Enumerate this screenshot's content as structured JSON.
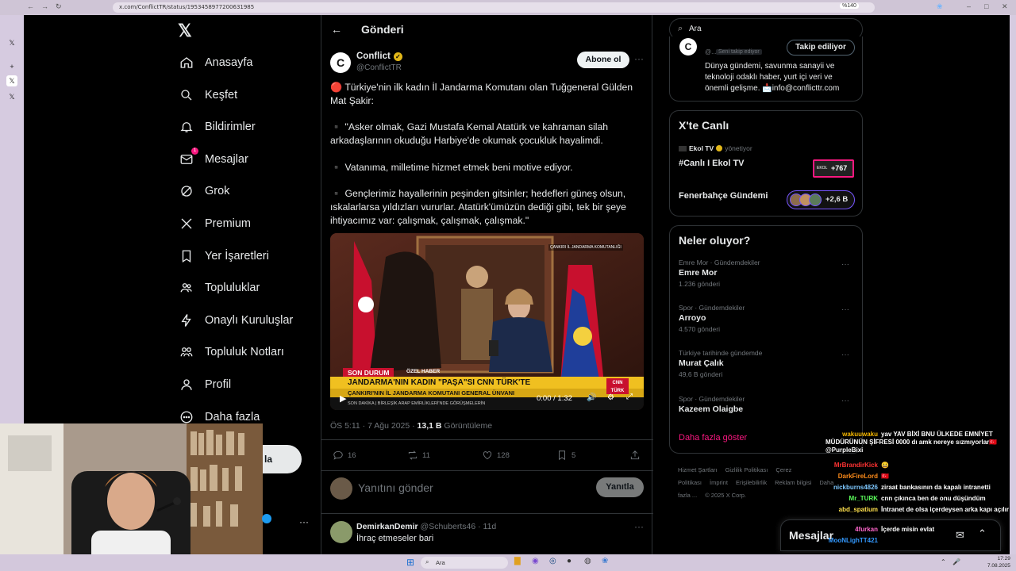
{
  "browser": {
    "url": "x.com/ConflictTR/status/1953458977200631985",
    "zoom": "%140"
  },
  "left_nav": {
    "items": [
      {
        "label": "Anasayfa",
        "icon": "home-icon"
      },
      {
        "label": "Keşfet",
        "icon": "search-icon"
      },
      {
        "label": "Bildirimler",
        "icon": "bell-icon"
      },
      {
        "label": "Mesajlar",
        "icon": "mail-icon",
        "badge": "1"
      },
      {
        "label": "Grok",
        "icon": "grok-icon"
      },
      {
        "label": "Premium",
        "icon": "x-logo-icon"
      },
      {
        "label": "Yer İşaretleri",
        "icon": "bookmark-icon"
      },
      {
        "label": "Topluluklar",
        "icon": "people-icon"
      },
      {
        "label": "Onaylı Kuruluşlar",
        "icon": "lightning-icon"
      },
      {
        "label": "Topluluk Notları",
        "icon": "notes-icon"
      },
      {
        "label": "Profil",
        "icon": "profile-icon"
      },
      {
        "label": "Daha fazla",
        "icon": "more-circle-icon"
      }
    ],
    "post_button_fragment": "la"
  },
  "main": {
    "header_title": "Gönderi",
    "author_name": "Conflict",
    "author_handle": "@ConflictTR",
    "subscribe_label": "Abone ol",
    "tweet_paragraphs": [
      "🔴 Türkiye'nin ilk kadın İl Jandarma Komutanı olan Tuğgeneral Gülden Mat Şakir:",
      "▪️ \"Asker olmak, Gazi Mustafa Kemal Atatürk ve kahraman silah arkadaşlarının okuduğu Harbiye'de okumak çocukluk hayalimdi.",
      "▪️ Vatanıma, milletime hizmet etmek beni motive ediyor.",
      "▪️ Gençlerimiz hayallerinin peşinden gitsinler; hedefleri güneş olsun, ıskalarlarsa yıldızları vururlar. Atatürk'ümüzün dediği gibi, tek bir şeye ihtiyacımız var: çalışmak, çalışmak, çalışmak.\""
    ],
    "video": {
      "location_tag": "ÇANKIRI İL JANDARMA KOMUTANLIĞI",
      "breaking_label": "SON DURUM",
      "special_label": "ÖZEL HABER",
      "headline": "JANDARMA'NIN KADIN \"PAŞA\"SI CNN TÜRK'TE",
      "subheadline": "ÇANKIRI'NIN İL JANDARMA KOMUTANI GENERAL ÜNVANI",
      "ticker": "SON DAKİKA | BİRLEŞİK ARAP EMİRLİKLERİ'NDE GÖRÜŞMELERİN",
      "channel_logo": "CNN TÜRK",
      "time": "0:00 / 1:32"
    },
    "meta_time": "ÖS 5:11 · 7 Ağu 2025 · ",
    "views_count": "13,1 B",
    "views_label": " Görüntüleme",
    "actions": {
      "replies": "16",
      "reposts": "11",
      "likes": "128",
      "bookmarks": "5"
    },
    "reply_placeholder": "Yanıtını gönder",
    "reply_button": "Yanıtla",
    "reply": {
      "name": "DemirkanDemir",
      "handle": "@Schuberts46",
      "age": "11d",
      "text": "İhraç etmeseler bari"
    }
  },
  "right": {
    "search_placeholder": "Ara",
    "profile_card": {
      "follow_label": "Takip ediliyor",
      "follows_you": "Seni takip ediyor",
      "handle_fragment": "@...",
      "bio": "Dünya gündemi, savunma sanayii ve teknoloji odaklı haber, yurt içi veri ve önemli gelişme. 📩info@conflicttr.com"
    },
    "live": {
      "title": "X'te Canlı",
      "host": "Ekol TV",
      "host_suffix": "yönetiyor",
      "stream_title": "#Canlı I Ekol TV",
      "stream_count": "+767",
      "space_title": "Fenerbahçe Gündemi",
      "space_count": "+2,6 B"
    },
    "trends": {
      "title": "Neler oluyor?",
      "items": [
        {
          "category": "Emre Mor · Gündemdekiler",
          "name": "Emre Mor",
          "count": "1.236 gönderi"
        },
        {
          "category": "Spor · Gündemdekiler",
          "name": "Arroyo",
          "count": "4.570 gönderi"
        },
        {
          "category": "Türkiye tarihinde gündemde",
          "name": "Murat Çalık",
          "count": "49,6 B gönderi"
        },
        {
          "category": "Spor · Gündemdekiler",
          "name": "Kazeem Olaigbe",
          "count": ""
        }
      ],
      "show_more": "Daha fazla göster"
    },
    "footer": [
      "Hizmet Şartları",
      "Gizlilik Politikası",
      "Çerez Politikası",
      "İmprint",
      "Erişilebilirlik",
      "Reklam bilgisi",
      "Daha fazla ...",
      "© 2025 X Corp."
    ],
    "messages_dock": "Mesajlar"
  },
  "chat": [
    {
      "user": "wakuuwaku",
      "color": "#f5b700",
      "msg": "yav YAV BİXİ BNU ÜLKEDE EMNİYET MÜDÜRÜNÜN ŞİFRESİ 0000 dı amk nereye sızmıyorlar🇹🇷 @PurpleBixi"
    },
    {
      "user": "MrBrandirKick",
      "color": "#ff3333",
      "msg": "😀"
    },
    {
      "user": "DarkFireLord",
      "color": "#ff8c1a",
      "msg": "🇹🇷"
    },
    {
      "user": "nickburns4826",
      "color": "#7ec8ff",
      "msg": "ziraat bankasının da kapalı intranetti"
    },
    {
      "user": "Mr_TURK",
      "color": "#5cff5c",
      "msg": "cnn çıkınca ben de onu düşündüm"
    },
    {
      "user": "abd_spatium",
      "color": "#ffe14d",
      "msg": "İntranet de olsa içerdeysen arka kapı açılır"
    },
    {
      "user": "4furkan",
      "color": "#ff66cc",
      "msg": "İçerde misin evlat"
    },
    {
      "user": "MooNLighTT421",
      "color": "#3399ff",
      "msg": ""
    }
  ],
  "taskbar": {
    "search": "Ara",
    "time": "17:29",
    "date": "7.08.2025"
  }
}
